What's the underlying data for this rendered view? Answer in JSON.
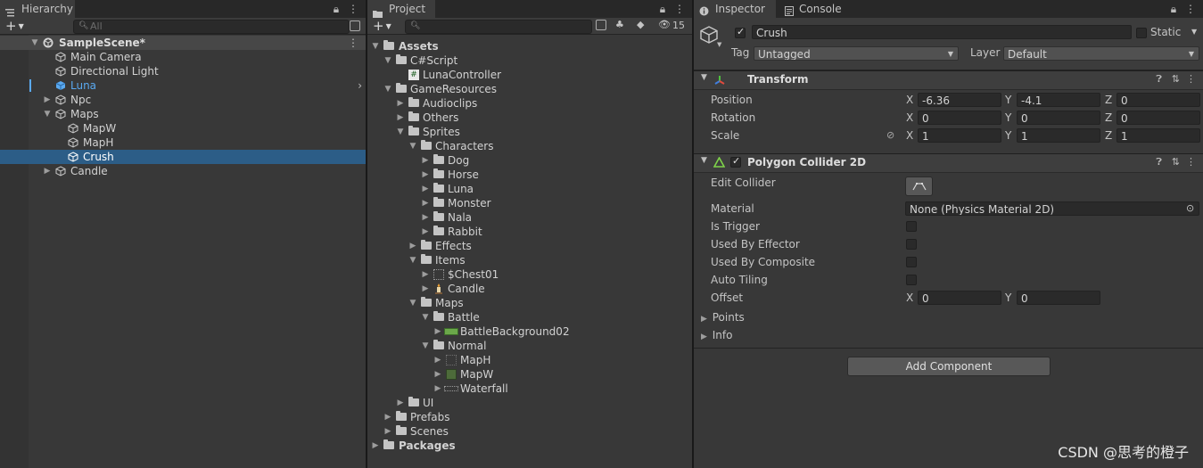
{
  "hierarchy": {
    "tab_label": "Hierarchy",
    "search_placeholder": "All",
    "scene_name": "SampleScene*",
    "items": [
      {
        "label": "Main Camera"
      },
      {
        "label": "Directional Light"
      },
      {
        "label": "Luna"
      },
      {
        "label": "Npc"
      },
      {
        "label": "Maps"
      },
      {
        "label": "MapW"
      },
      {
        "label": "MapH"
      },
      {
        "label": "Crush"
      },
      {
        "label": "Candle"
      }
    ]
  },
  "project": {
    "tab_label": "Project",
    "hidden_count": "15",
    "tree": [
      {
        "label": "Assets"
      },
      {
        "label": "C#Script"
      },
      {
        "label": "LunaController"
      },
      {
        "label": "GameResources"
      },
      {
        "label": "Audioclips"
      },
      {
        "label": "Others"
      },
      {
        "label": "Sprites"
      },
      {
        "label": "Characters"
      },
      {
        "label": "Dog"
      },
      {
        "label": "Horse"
      },
      {
        "label": "Luna"
      },
      {
        "label": "Monster"
      },
      {
        "label": "Nala"
      },
      {
        "label": "Rabbit"
      },
      {
        "label": "Effects"
      },
      {
        "label": "Items"
      },
      {
        "label": "$Chest01"
      },
      {
        "label": "Candle"
      },
      {
        "label": "Maps"
      },
      {
        "label": "Battle"
      },
      {
        "label": "BattleBackground02"
      },
      {
        "label": "Normal"
      },
      {
        "label": "MapH"
      },
      {
        "label": "MapW"
      },
      {
        "label": "Waterfall"
      },
      {
        "label": "UI"
      },
      {
        "label": "Prefabs"
      },
      {
        "label": "Scenes"
      },
      {
        "label": "Packages"
      }
    ]
  },
  "inspector": {
    "tab_label": "Inspector",
    "console_tab_label": "Console",
    "object_name": "Crush",
    "static_label": "Static",
    "tag_label": "Tag",
    "tag_value": "Untagged",
    "layer_label": "Layer",
    "layer_value": "Default",
    "transform": {
      "title": "Transform",
      "position_label": "Position",
      "rotation_label": "Rotation",
      "scale_label": "Scale",
      "x_label": "X",
      "y_label": "Y",
      "z_label": "Z",
      "position": {
        "x": "-6.36",
        "y": "-4.1",
        "z": "0"
      },
      "rotation": {
        "x": "0",
        "y": "0",
        "z": "0"
      },
      "scale": {
        "x": "1",
        "y": "1",
        "z": "1"
      }
    },
    "collider": {
      "title": "Polygon Collider 2D",
      "edit_collider_label": "Edit Collider",
      "material_label": "Material",
      "material_value": "None (Physics Material 2D)",
      "is_trigger_label": "Is Trigger",
      "used_by_effector_label": "Used By Effector",
      "used_by_composite_label": "Used By Composite",
      "auto_tiling_label": "Auto Tiling",
      "offset_label": "Offset",
      "offset": {
        "x": "0",
        "y": "0"
      },
      "points_label": "Points",
      "info_label": "Info"
    },
    "add_component_label": "Add Component"
  },
  "watermark": "CSDN @思考的橙子",
  "colors": {
    "selection": "#2c5d87",
    "panel": "#383838",
    "luna_text": "#5aa9f0"
  }
}
